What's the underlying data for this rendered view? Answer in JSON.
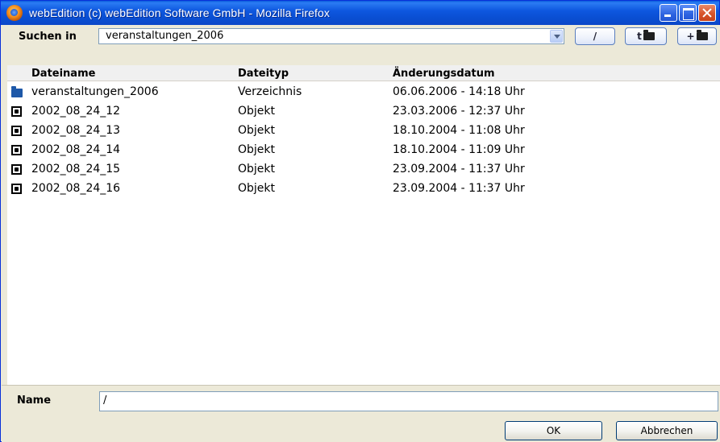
{
  "window": {
    "title": "webEdition (c) webEdition Software GmbH - Mozilla Firefox"
  },
  "toolbar": {
    "search_label": "Suchen in",
    "current_directory": "veranstaltungen_2006",
    "root_button_label": "/",
    "up_button_label": "t",
    "new_folder_button_label": "+"
  },
  "file_list": {
    "columns": [
      "Dateiname",
      "Dateityp",
      "Änderungsdatum"
    ],
    "rows": [
      {
        "icon": "folder-icon",
        "name": "veranstaltungen_2006",
        "type": "Verzeichnis",
        "date": "06.06.2006 - 14:18 Uhr"
      },
      {
        "icon": "object-icon",
        "name": "2002_08_24_12",
        "type": "Objekt",
        "date": "23.03.2006 - 12:37 Uhr"
      },
      {
        "icon": "object-icon",
        "name": "2002_08_24_13",
        "type": "Objekt",
        "date": "18.10.2004 - 11:08 Uhr"
      },
      {
        "icon": "object-icon",
        "name": "2002_08_24_14",
        "type": "Objekt",
        "date": "18.10.2004 - 11:09 Uhr"
      },
      {
        "icon": "object-icon",
        "name": "2002_08_24_15",
        "type": "Objekt",
        "date": "23.09.2004 - 11:37 Uhr"
      },
      {
        "icon": "object-icon",
        "name": "2002_08_24_16",
        "type": "Objekt",
        "date": "23.09.2004 - 11:37 Uhr"
      }
    ]
  },
  "footer": {
    "name_label": "Name",
    "name_value": "/",
    "ok_label": "OK",
    "cancel_label": "Abbrechen"
  },
  "colors": {
    "titlebar": "#0a4fd3",
    "folder_icon": "#1e58a8",
    "dialog_background": "#ece9d8"
  }
}
